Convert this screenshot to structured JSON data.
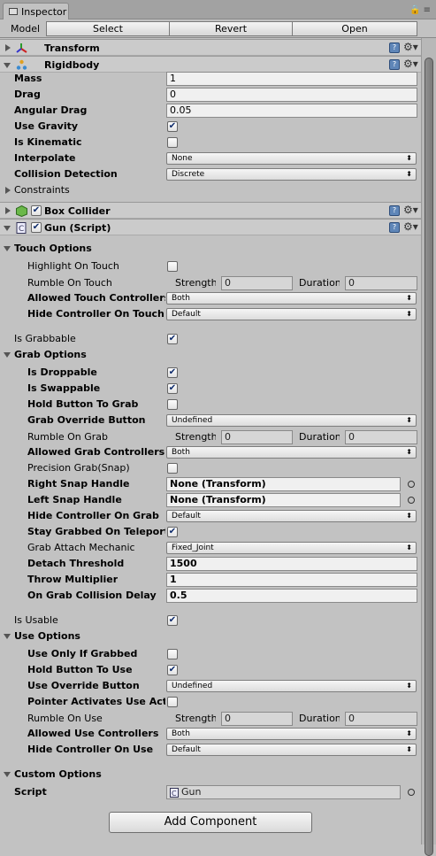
{
  "tab": {
    "title": "Inspector"
  },
  "toolbar": {
    "model_label": "Model",
    "select": "Select",
    "revert": "Revert",
    "open": "Open"
  },
  "components": {
    "transform": "Transform",
    "rigidbody": "Rigidbody",
    "box_collider": "Box Collider",
    "gun_script": "Gun (Script)"
  },
  "rigidbody": {
    "mass_label": "Mass",
    "mass": "1",
    "drag_label": "Drag",
    "drag": "0",
    "angular_drag_label": "Angular Drag",
    "angular_drag": "0.05",
    "use_gravity_label": "Use Gravity",
    "use_gravity": "✔",
    "is_kinematic_label": "Is Kinematic",
    "interpolate_label": "Interpolate",
    "interpolate": "None",
    "collision_label": "Collision Detection",
    "collision": "Discrete",
    "constraints_label": "Constraints"
  },
  "touch": {
    "header": "Touch Options",
    "highlight_label": "Highlight On Touch",
    "rumble_label": "Rumble On Touch",
    "strength_label": "Strength",
    "strength": "0",
    "duration_label": "Duration",
    "duration": "0",
    "allowed_label": "Allowed Touch Controllers",
    "allowed": "Both",
    "hide_label": "Hide Controller On Touch",
    "hide": "Default"
  },
  "grabbable_label": "Is Grabbable",
  "grabbable": "✔",
  "grab": {
    "header": "Grab Options",
    "droppable_label": "Is Droppable",
    "droppable": "✔",
    "swappable_label": "Is Swappable",
    "swappable": "✔",
    "hold_label": "Hold Button To Grab",
    "override_label": "Grab Override Button",
    "override": "Undefined",
    "rumble_label": "Rumble On Grab",
    "strength_label": "Strength",
    "strength": "0",
    "duration_label": "Duration",
    "duration": "0",
    "allowed_label": "Allowed Grab Controllers",
    "allowed": "Both",
    "precision_label": "Precision Grab(Snap)",
    "right_snap_label": "Right Snap Handle",
    "right_snap": "None (Transform)",
    "left_snap_label": "Left Snap Handle",
    "left_snap": "None (Transform)",
    "hide_label": "Hide Controller On Grab",
    "hide": "Default",
    "stay_label": "Stay Grabbed On Teleport",
    "stay": "✔",
    "attach_label": "Grab Attach Mechanic",
    "attach": "Fixed_Joint",
    "detach_label": "Detach Threshold",
    "detach": "1500",
    "throw_label": "Throw Multiplier",
    "throw": "1",
    "collision_delay_label": "On Grab Collision Delay",
    "collision_delay": "0.5"
  },
  "usable_label": "Is Usable",
  "usable": "✔",
  "use": {
    "header": "Use Options",
    "only_grabbed_label": "Use Only If Grabbed",
    "hold_label": "Hold Button To Use",
    "hold": "✔",
    "override_label": "Use Override Button",
    "override": "Undefined",
    "pointer_label": "Pointer Activates Use Action",
    "rumble_label": "Rumble On Use",
    "strength_label": "Strength",
    "strength": "0",
    "duration_label": "Duration",
    "duration": "0",
    "allowed_label": "Allowed Use Controllers",
    "allowed": "Both",
    "hide_label": "Hide Controller On Use",
    "hide": "Default"
  },
  "custom": {
    "header": "Custom Options",
    "script_label": "Script",
    "script": "Gun"
  },
  "add_component": "Add Component"
}
